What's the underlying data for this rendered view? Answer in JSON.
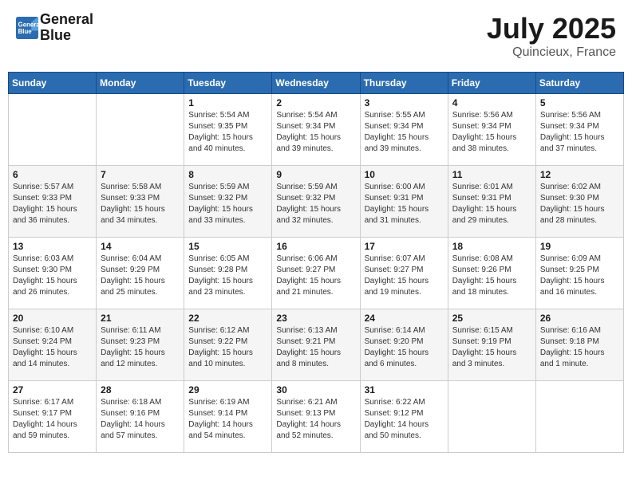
{
  "header": {
    "logo_line1": "General",
    "logo_line2": "Blue",
    "month_title": "July 2025",
    "location": "Quincieux, France"
  },
  "days_of_week": [
    "Sunday",
    "Monday",
    "Tuesday",
    "Wednesday",
    "Thursday",
    "Friday",
    "Saturday"
  ],
  "weeks": [
    [
      {
        "num": "",
        "info": ""
      },
      {
        "num": "",
        "info": ""
      },
      {
        "num": "1",
        "info": "Sunrise: 5:54 AM\nSunset: 9:35 PM\nDaylight: 15 hours\nand 40 minutes."
      },
      {
        "num": "2",
        "info": "Sunrise: 5:54 AM\nSunset: 9:34 PM\nDaylight: 15 hours\nand 39 minutes."
      },
      {
        "num": "3",
        "info": "Sunrise: 5:55 AM\nSunset: 9:34 PM\nDaylight: 15 hours\nand 39 minutes."
      },
      {
        "num": "4",
        "info": "Sunrise: 5:56 AM\nSunset: 9:34 PM\nDaylight: 15 hours\nand 38 minutes."
      },
      {
        "num": "5",
        "info": "Sunrise: 5:56 AM\nSunset: 9:34 PM\nDaylight: 15 hours\nand 37 minutes."
      }
    ],
    [
      {
        "num": "6",
        "info": "Sunrise: 5:57 AM\nSunset: 9:33 PM\nDaylight: 15 hours\nand 36 minutes."
      },
      {
        "num": "7",
        "info": "Sunrise: 5:58 AM\nSunset: 9:33 PM\nDaylight: 15 hours\nand 34 minutes."
      },
      {
        "num": "8",
        "info": "Sunrise: 5:59 AM\nSunset: 9:32 PM\nDaylight: 15 hours\nand 33 minutes."
      },
      {
        "num": "9",
        "info": "Sunrise: 5:59 AM\nSunset: 9:32 PM\nDaylight: 15 hours\nand 32 minutes."
      },
      {
        "num": "10",
        "info": "Sunrise: 6:00 AM\nSunset: 9:31 PM\nDaylight: 15 hours\nand 31 minutes."
      },
      {
        "num": "11",
        "info": "Sunrise: 6:01 AM\nSunset: 9:31 PM\nDaylight: 15 hours\nand 29 minutes."
      },
      {
        "num": "12",
        "info": "Sunrise: 6:02 AM\nSunset: 9:30 PM\nDaylight: 15 hours\nand 28 minutes."
      }
    ],
    [
      {
        "num": "13",
        "info": "Sunrise: 6:03 AM\nSunset: 9:30 PM\nDaylight: 15 hours\nand 26 minutes."
      },
      {
        "num": "14",
        "info": "Sunrise: 6:04 AM\nSunset: 9:29 PM\nDaylight: 15 hours\nand 25 minutes."
      },
      {
        "num": "15",
        "info": "Sunrise: 6:05 AM\nSunset: 9:28 PM\nDaylight: 15 hours\nand 23 minutes."
      },
      {
        "num": "16",
        "info": "Sunrise: 6:06 AM\nSunset: 9:27 PM\nDaylight: 15 hours\nand 21 minutes."
      },
      {
        "num": "17",
        "info": "Sunrise: 6:07 AM\nSunset: 9:27 PM\nDaylight: 15 hours\nand 19 minutes."
      },
      {
        "num": "18",
        "info": "Sunrise: 6:08 AM\nSunset: 9:26 PM\nDaylight: 15 hours\nand 18 minutes."
      },
      {
        "num": "19",
        "info": "Sunrise: 6:09 AM\nSunset: 9:25 PM\nDaylight: 15 hours\nand 16 minutes."
      }
    ],
    [
      {
        "num": "20",
        "info": "Sunrise: 6:10 AM\nSunset: 9:24 PM\nDaylight: 15 hours\nand 14 minutes."
      },
      {
        "num": "21",
        "info": "Sunrise: 6:11 AM\nSunset: 9:23 PM\nDaylight: 15 hours\nand 12 minutes."
      },
      {
        "num": "22",
        "info": "Sunrise: 6:12 AM\nSunset: 9:22 PM\nDaylight: 15 hours\nand 10 minutes."
      },
      {
        "num": "23",
        "info": "Sunrise: 6:13 AM\nSunset: 9:21 PM\nDaylight: 15 hours\nand 8 minutes."
      },
      {
        "num": "24",
        "info": "Sunrise: 6:14 AM\nSunset: 9:20 PM\nDaylight: 15 hours\nand 6 minutes."
      },
      {
        "num": "25",
        "info": "Sunrise: 6:15 AM\nSunset: 9:19 PM\nDaylight: 15 hours\nand 3 minutes."
      },
      {
        "num": "26",
        "info": "Sunrise: 6:16 AM\nSunset: 9:18 PM\nDaylight: 15 hours\nand 1 minute."
      }
    ],
    [
      {
        "num": "27",
        "info": "Sunrise: 6:17 AM\nSunset: 9:17 PM\nDaylight: 14 hours\nand 59 minutes."
      },
      {
        "num": "28",
        "info": "Sunrise: 6:18 AM\nSunset: 9:16 PM\nDaylight: 14 hours\nand 57 minutes."
      },
      {
        "num": "29",
        "info": "Sunrise: 6:19 AM\nSunset: 9:14 PM\nDaylight: 14 hours\nand 54 minutes."
      },
      {
        "num": "30",
        "info": "Sunrise: 6:21 AM\nSunset: 9:13 PM\nDaylight: 14 hours\nand 52 minutes."
      },
      {
        "num": "31",
        "info": "Sunrise: 6:22 AM\nSunset: 9:12 PM\nDaylight: 14 hours\nand 50 minutes."
      },
      {
        "num": "",
        "info": ""
      },
      {
        "num": "",
        "info": ""
      }
    ]
  ]
}
